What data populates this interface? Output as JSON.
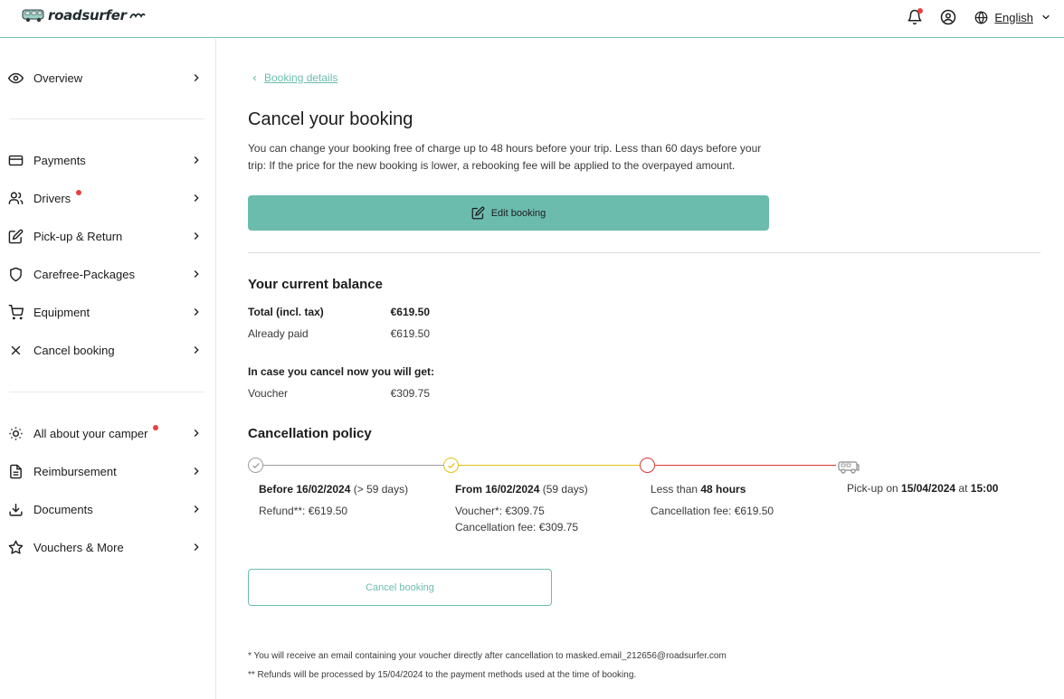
{
  "header": {
    "brand": "roadsurfer",
    "language": "English"
  },
  "sidebar": {
    "items": [
      {
        "label": "Overview",
        "icon": "eye-icon"
      },
      {
        "label": "Payments",
        "icon": "credit-card-icon"
      },
      {
        "label": "Drivers",
        "icon": "users-icon",
        "dot": true
      },
      {
        "label": "Pick-up & Return",
        "icon": "edit-icon"
      },
      {
        "label": "Carefree-Packages",
        "icon": "shield-icon"
      },
      {
        "label": "Equipment",
        "icon": "cart-icon"
      },
      {
        "label": "Cancel booking",
        "icon": "close-icon"
      },
      {
        "label": "All about your camper",
        "icon": "bulb-icon",
        "dot": true
      },
      {
        "label": "Reimbursement",
        "icon": "receipt-icon"
      },
      {
        "label": "Documents",
        "icon": "download-icon"
      },
      {
        "label": "Vouchers & More",
        "icon": "star-icon"
      }
    ]
  },
  "main": {
    "back_link": "Booking details",
    "title": "Cancel your booking",
    "intro": "You can change your booking free of charge up to 48 hours before your trip. Less than 60 days before your trip: If the price for the new booking is lower, a rebooking fee will be applied to the overpayed amount.",
    "edit_button": "Edit booking",
    "balance": {
      "heading": "Your current balance",
      "total_label": "Total (incl. tax)",
      "total_value": "€619.50",
      "paid_label": "Already paid",
      "paid_value": "€619.50",
      "cancel_heading": "In case you cancel now you will get:",
      "voucher_label": "Voucher",
      "voucher_value": "€309.75"
    },
    "policy": {
      "heading": "Cancellation policy",
      "stage1": {
        "date_prefix": "Before ",
        "date": "16/02/2024",
        "days": " (> 59 days)",
        "line2": "Refund**: €619.50"
      },
      "stage2": {
        "date_prefix": "From ",
        "date": "16/02/2024",
        "days": " (59 days)",
        "line2": "Voucher*: €309.75",
        "line3": "Cancellation fee: €309.75"
      },
      "stage3": {
        "date_prefix": "Less than ",
        "date": "48 hours",
        "line2": "Cancellation fee: €619.50"
      },
      "stage4": {
        "prefix": "Pick-up on ",
        "date": "15/04/2024",
        "at": " at ",
        "time": "15:00"
      }
    },
    "cancel_button": "Cancel booking",
    "footnote1": "* You will receive an email containing your voucher directly after cancellation to masked.email_212656@roadsurfer.com",
    "footnote2": "** Refunds will be processed by 15/04/2024 to the payment methods used at the time of booking."
  },
  "colors": {
    "accent": "#6cbcae",
    "alert": "#e8403d",
    "stage_past": "#9e9e9e",
    "stage_current": "#e3c01c",
    "stage_late": "#d83a36"
  }
}
